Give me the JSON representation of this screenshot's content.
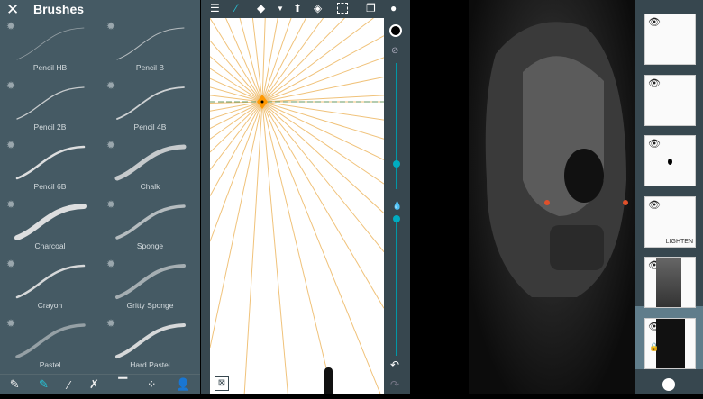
{
  "brushes_panel": {
    "title": "Brushes",
    "close_icon": "close-icon",
    "brushes": [
      {
        "label": "Pencil HB",
        "w": 0.8,
        "o": 0.5
      },
      {
        "label": "Pencil B",
        "w": 1,
        "o": 0.7
      },
      {
        "label": "Pencil 2B",
        "w": 1.3,
        "o": 0.8
      },
      {
        "label": "Pencil 4B",
        "w": 1.8,
        "o": 0.85
      },
      {
        "label": "Pencil 6B",
        "w": 2.5,
        "o": 0.95
      },
      {
        "label": "Chalk",
        "w": 5,
        "o": 0.8
      },
      {
        "label": "Charcoal",
        "w": 6,
        "o": 0.95
      },
      {
        "label": "Sponge",
        "w": 3.5,
        "o": 0.7
      },
      {
        "label": "Crayon",
        "w": 2.5,
        "o": 0.9
      },
      {
        "label": "Gritty Sponge",
        "w": 4,
        "o": 0.6
      },
      {
        "label": "Pastel",
        "w": 3.5,
        "o": 0.5
      },
      {
        "label": "Hard Pastel",
        "w": 4,
        "o": 0.9
      }
    ],
    "tool_icons": [
      "pencil-icon",
      "brush-active-icon",
      "paintbrush-icon",
      "spray-icon",
      "roller-icon",
      "blend-icon",
      "person-icon"
    ]
  },
  "toolbar": {
    "icons": [
      "menu-icon",
      "brush-icon",
      "eraser-icon",
      "dropdown-icon",
      "smudge-icon",
      "fill-icon",
      "selection-icon",
      "layers-icon"
    ]
  },
  "side_tools": {
    "size_value": 0.8,
    "opacity_value": 0.02
  },
  "layers": [
    {
      "name": ""
    },
    {
      "name": ""
    },
    {
      "name": ""
    },
    {
      "name": "",
      "blend": "LIGHTEN"
    },
    {
      "name": ""
    },
    {
      "name": "",
      "locked": true
    }
  ],
  "accent": "#00acc1"
}
